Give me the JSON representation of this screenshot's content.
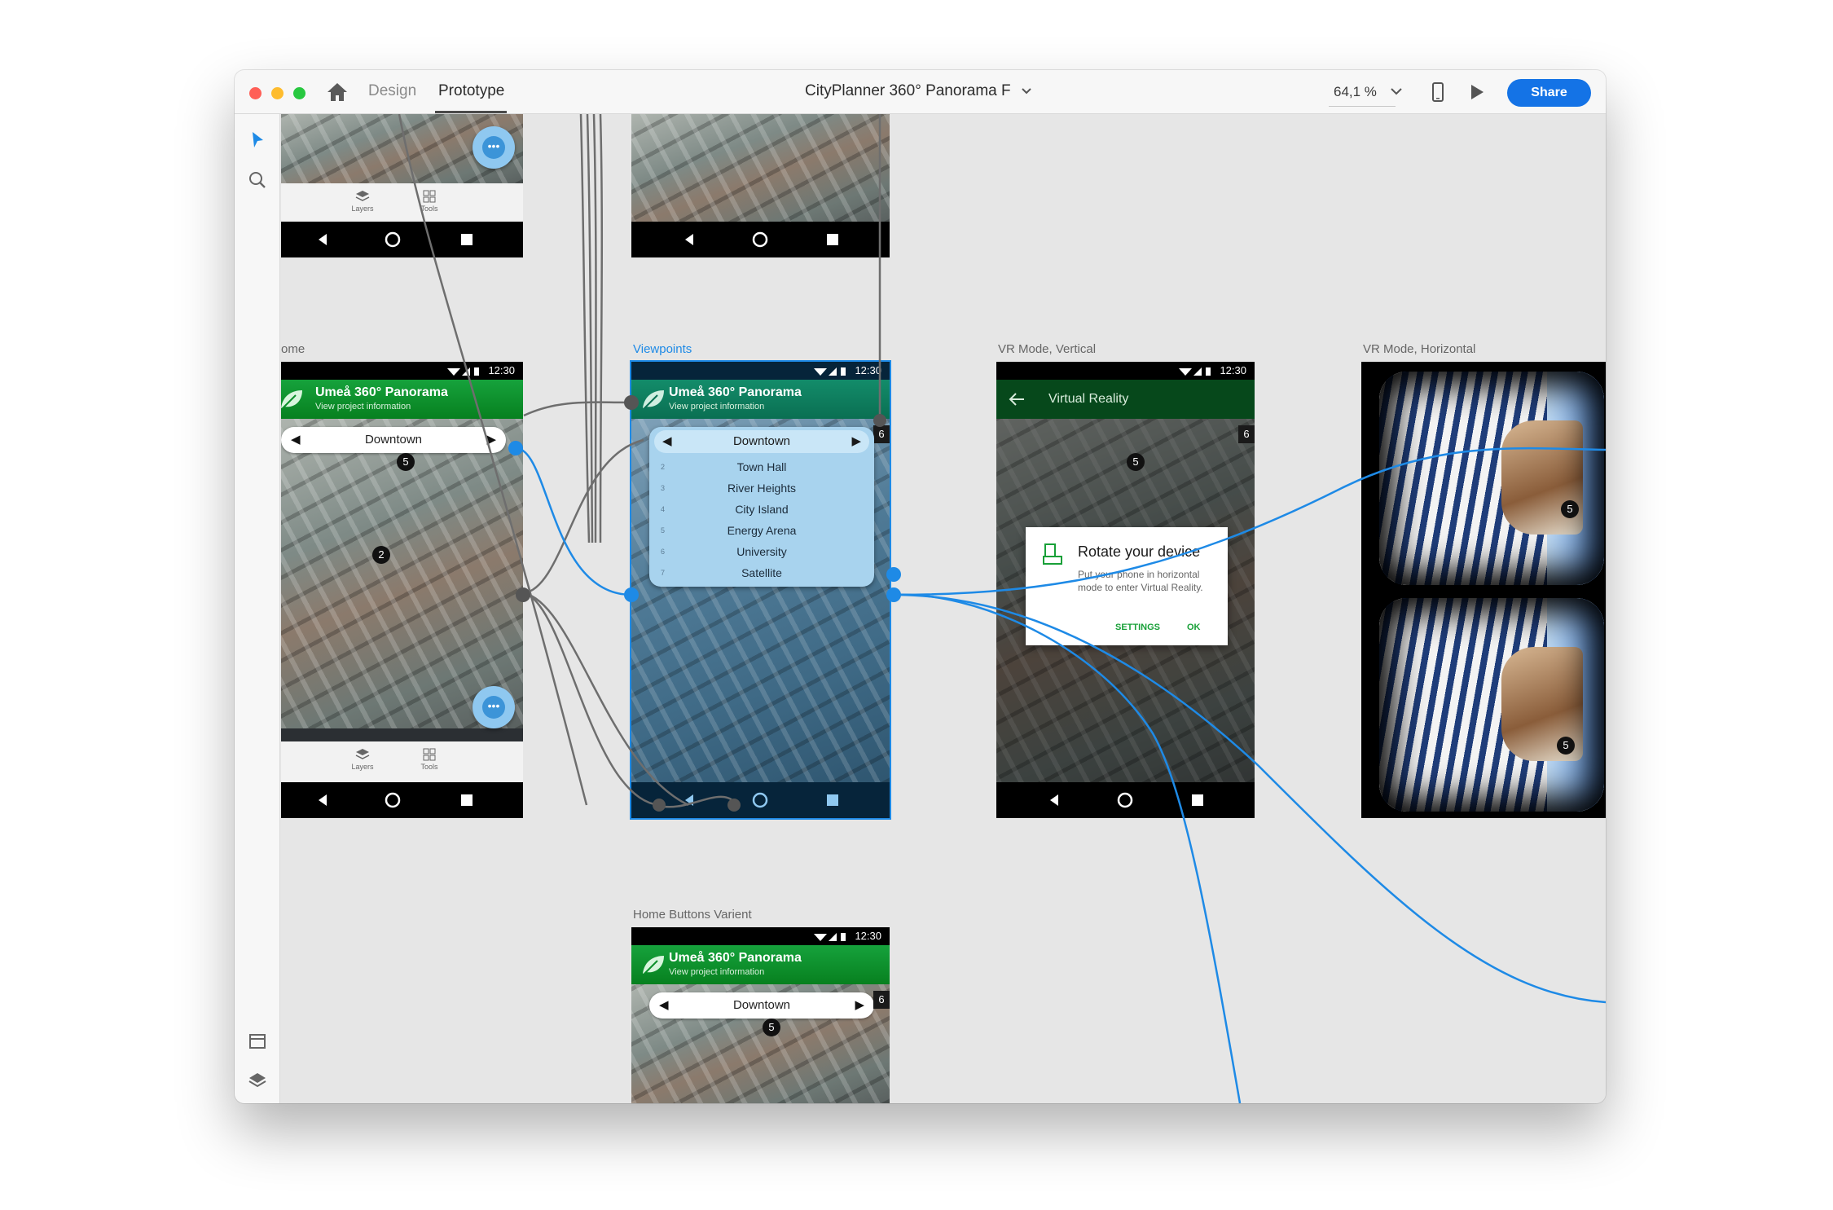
{
  "window": {
    "tabs": {
      "design": "Design",
      "prototype": "Prototype"
    },
    "document_title": "CityPlanner 360° Panorama F",
    "zoom": "64,1 %",
    "share_label": "Share"
  },
  "artboards": {
    "home_label": "ome",
    "viewpoints_label": "Viewpoints",
    "vr_vertical_label": "VR Mode, Vertical",
    "vr_horizontal_label": "VR Mode, Horizontal",
    "home_buttons_label": "Home Buttons Varient"
  },
  "phone": {
    "status_time": "12:30",
    "app_title": "Umeå 360° Panorama",
    "app_subtitle": "View project information",
    "viewpoint": "Downtown",
    "bottom_tabs": [
      "Layers",
      "Tools"
    ],
    "pins": {
      "five": "5",
      "two": "2",
      "six": "6"
    }
  },
  "viewpoint_list": [
    {
      "num": "2",
      "label": "Town Hall"
    },
    {
      "num": "3",
      "label": "River Heights"
    },
    {
      "num": "4",
      "label": "City Island"
    },
    {
      "num": "5",
      "label": "Energy Arena"
    },
    {
      "num": "6",
      "label": "University"
    },
    {
      "num": "7",
      "label": "Satellite"
    }
  ],
  "vr_vertical": {
    "header": "Virtual Reality",
    "dialog_title": "Rotate your device",
    "dialog_body": "Put your phone in horizontal mode to enter Virtual Reality.",
    "dialog_settings": "SETTINGS",
    "dialog_ok": "OK"
  },
  "vr_horizontal": {
    "pin": "5"
  },
  "colors": {
    "accent": "#1473e6",
    "wire": "#1e8ae6",
    "app_green": "#0b8f2a",
    "status_black": "#000000"
  }
}
